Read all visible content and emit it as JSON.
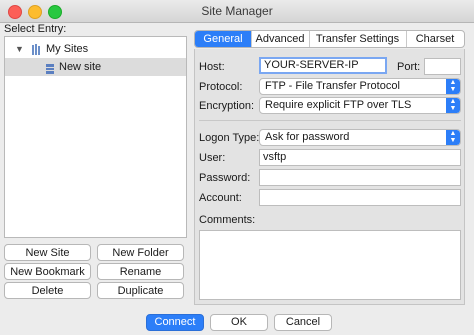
{
  "window": {
    "title": "Site Manager"
  },
  "left": {
    "select_entry_label": "Select Entry:",
    "tree": [
      {
        "label": "My Sites",
        "icon": "folder-icon",
        "expanded": true
      },
      {
        "label": "New site",
        "icon": "server-icon",
        "selected": true
      }
    ],
    "buttons": {
      "new_site": "New Site",
      "new_folder": "New Folder",
      "new_bookmark": "New Bookmark",
      "rename": "Rename",
      "delete": "Delete",
      "duplicate": "Duplicate"
    }
  },
  "tabs": [
    "General",
    "Advanced",
    "Transfer Settings",
    "Charset"
  ],
  "active_tab": "General",
  "general": {
    "host_label": "Host:",
    "host_value": "YOUR-SERVER-IP",
    "port_label": "Port:",
    "port_value": "",
    "protocol_label": "Protocol:",
    "protocol_value": "FTP - File Transfer Protocol",
    "encryption_label": "Encryption:",
    "encryption_value": "Require explicit FTP over TLS",
    "logon_type_label": "Logon Type:",
    "logon_type_value": "Ask for password",
    "user_label": "User:",
    "user_value": "vsftp",
    "password_label": "Password:",
    "password_value": "",
    "account_label": "Account:",
    "account_value": "",
    "comments_label": "Comments:",
    "comments_value": ""
  },
  "footer": {
    "connect": "Connect",
    "ok": "OK",
    "cancel": "Cancel"
  },
  "colors": {
    "accent": "#2c7ef8"
  }
}
